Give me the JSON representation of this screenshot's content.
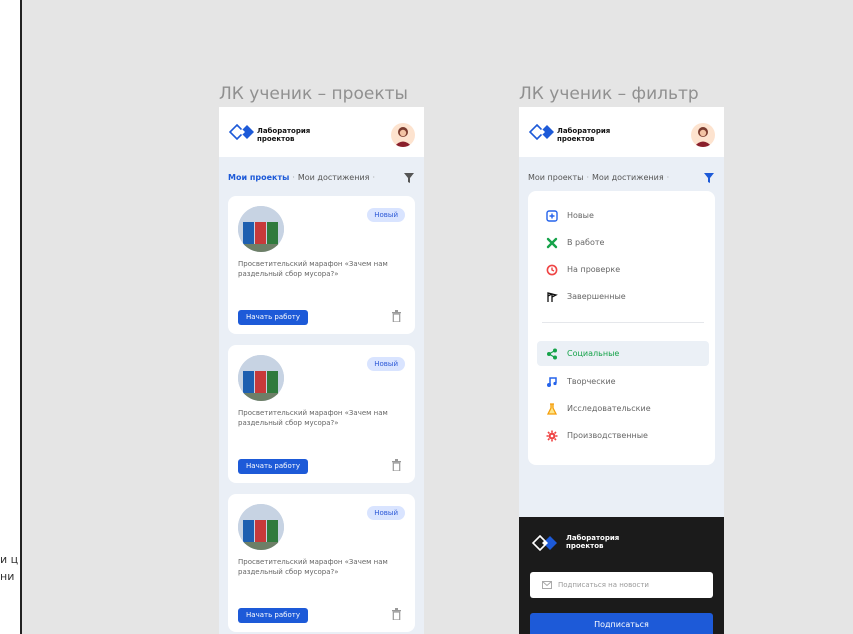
{
  "left_fragment": {
    "lines": [
      "и ц",
      "ни"
    ]
  },
  "frames": [
    {
      "title": "ЛК ученик – проекты",
      "brand": "Лаборатория\nпроектов",
      "tabs": {
        "my_projects": "Мои проекты",
        "achievements": "Мои достижения",
        "separator": "·",
        "active": "my_projects"
      },
      "cards": [
        {
          "badge": "Новый",
          "description": "Просветительский марафон «Зачем нам раздельный сбор мусора?»",
          "button": "Начать работу"
        },
        {
          "badge": "Новый",
          "description": "Просветительский марафон «Зачем нам раздельный сбор мусора?»",
          "button": "Начать работу"
        },
        {
          "badge": "Новый",
          "description": "Просветительский марафон «Зачем нам раздельный сбор мусора?»",
          "button": "Начать работу"
        }
      ]
    },
    {
      "title": "ЛК ученик – фильтр",
      "brand": "Лаборатория\nпроектов",
      "tabs": {
        "my_projects": "Мои проекты",
        "achievements": "Мои достижения",
        "separator": "·"
      },
      "status_filters": [
        {
          "label": "Новые",
          "icon": "new-icon",
          "color": "#2563eb"
        },
        {
          "label": "В работе",
          "icon": "cross-tools-icon",
          "color": "#16a34a"
        },
        {
          "label": "На проверке",
          "icon": "clock-icon",
          "color": "#ef4444"
        },
        {
          "label": "Завершенные",
          "icon": "flags-icon",
          "color": "#111111"
        }
      ],
      "category_filters": [
        {
          "label": "Социальные",
          "icon": "share-icon",
          "color": "#16a34a",
          "selected": true
        },
        {
          "label": "Творческие",
          "icon": "music-note-icon",
          "color": "#2563eb"
        },
        {
          "label": "Исследовательские",
          "icon": "flask-icon",
          "color": "#f59e0b"
        },
        {
          "label": "Производственные",
          "icon": "gear-icon",
          "color": "#ef4444"
        }
      ],
      "footer": {
        "brand": "Лаборатория\nпроектов",
        "subscribe_placeholder": "Подписаться на новости",
        "subscribe_button": "Подписаться"
      }
    }
  ],
  "colors": {
    "accent": "#1d5ad8",
    "background": "#e5e5e5",
    "phone_bg": "#eaeff6",
    "footer_bg": "#1b1b1b"
  }
}
